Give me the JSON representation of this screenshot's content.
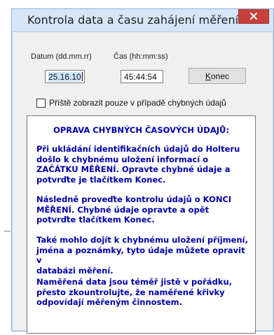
{
  "window": {
    "title": "Kontrola data a času zahájení měření"
  },
  "form": {
    "date_label": "Datum (dd.mm.rr)",
    "date_value": "25.16.10",
    "time_label": "Čas (hh:mm:ss)",
    "time_value": "45:44:54",
    "ok_button_accel": "K",
    "ok_button_rest": "onec",
    "checkbox_label": "Příště zobrazit pouze v případě chybných údajů",
    "checkbox_checked": false
  },
  "info": {
    "title": "OPRAVA CHYBNÝCH ČASOVÝCH ÚDAJŮ:",
    "paragraphs": [
      "Při ukládání identifikačních údajů do Holteru\ndošlo k chybnému uložení informací o\nZAČÁTKU MĚŘENÍ. Opravte chybné údaje a\npotvrďte je tlačítkem Konec.",
      "Následně proveďte kontrolu údajů o KONCI\nMĚŘENÍ. Chybné údaje opravte a opět\npotvrďte tlačítkem Konec.",
      "Také mohlo dojít k chybnému uložení příjmení,\njména a poznámky, tyto údaje můžete opravit v\ndatabázi měření.",
      "Naměřená data jsou téměř jistě v pořádku,\npřesto zkountrolujte, že naměřené křivky\nodpovídají měřeným činnostem."
    ]
  },
  "colors": {
    "info_text": "#0000a8",
    "close_button": "#c7413a",
    "titlebar": "#d6e6f8"
  }
}
